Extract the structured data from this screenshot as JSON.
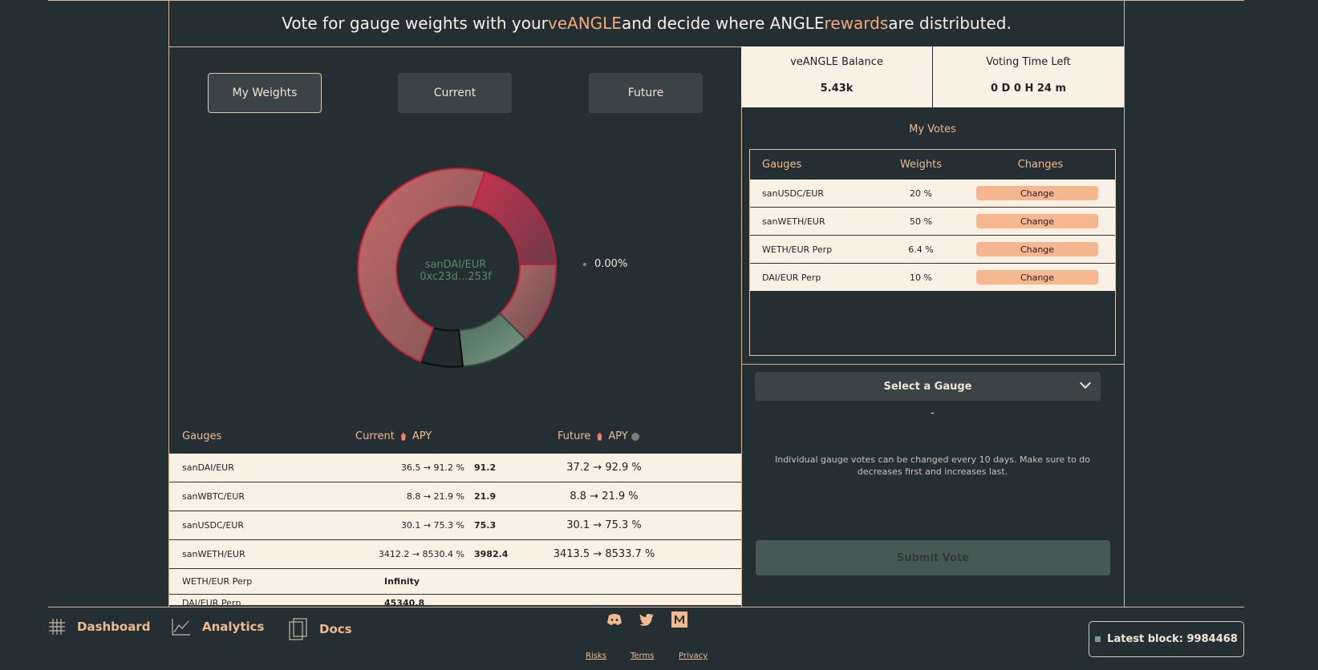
{
  "headline": {
    "part1": "Vote for gauge weights with your ",
    "accent1": "veANGLE",
    "part2": " and decide where ANGLE ",
    "accent2": "rewards",
    "part3": " are distributed."
  },
  "tabs": [
    {
      "label": "My Weights",
      "active": true
    },
    {
      "label": "Current",
      "active": false
    },
    {
      "label": "Future",
      "active": false
    }
  ],
  "donut": {
    "center_name": "sanDAI/EUR",
    "center_address": "0xc23d...253f",
    "legend_value": "0.00%"
  },
  "gauges_table": {
    "headers": {
      "gauges": "Gauges",
      "current": "Current",
      "apy": "APY",
      "future": "Future",
      "apy2": "APY"
    },
    "rows": [
      {
        "name": "sanDAI/EUR",
        "current": "36.5 → 91.2 %",
        "apy": "91.2",
        "future": "37.2 → 92.9 %"
      },
      {
        "name": "sanWBTC/EUR",
        "current": "8.8 → 21.9 %",
        "apy": "21.9",
        "future": "8.8 → 21.9 %"
      },
      {
        "name": "sanUSDC/EUR",
        "current": "30.1 → 75.3 %",
        "apy": "75.3",
        "future": "30.1 → 75.3 %"
      },
      {
        "name": "sanWETH/EUR",
        "current": "3412.2 → 8530.4 %",
        "apy": "3982.4",
        "future": "3413.5 → 8533.7 %"
      },
      {
        "name": "WETH/EUR Perp",
        "current": "",
        "apy": "Infinity",
        "future": ""
      },
      {
        "name": "DAI/EUR Perp",
        "current": "",
        "apy": "45340.8",
        "future": ""
      }
    ]
  },
  "balance": {
    "veangle_label": "veANGLE Balance",
    "veangle_value": "5.43k",
    "time_label": "Voting Time Left",
    "time_value": "0 D 0 H 24 m"
  },
  "my_votes": {
    "title": "My Votes",
    "headers": {
      "gauges": "Gauges",
      "weights": "Weights",
      "changes": "Changes"
    },
    "rows": [
      {
        "name": "sanUSDC/EUR",
        "weight": "20 %",
        "change": "Change"
      },
      {
        "name": "sanWETH/EUR",
        "weight": "50 %",
        "change": "Change"
      },
      {
        "name": "WETH/EUR Perp",
        "weight": "6.4 %",
        "change": "Change"
      },
      {
        "name": "DAI/EUR Perp",
        "weight": "10 %",
        "change": "Change"
      }
    ]
  },
  "vote_form": {
    "select_label": "Select a Gauge",
    "dash": "-",
    "note": "Individual gauge votes can be changed every 10 days. Make sure to do decreases first and increases last.",
    "submit": "Submit Vote"
  },
  "footer": {
    "nav": [
      {
        "label": "Dashboard",
        "icon": "grid-icon"
      },
      {
        "label": "Analytics",
        "icon": "chart-icon"
      },
      {
        "label": "Docs",
        "icon": "docs-icon"
      }
    ],
    "links": [
      "Risks",
      "Terms",
      "Privacy"
    ],
    "latest_block": "Latest block: 9984468"
  },
  "colors": {
    "background": "#232f32",
    "accent": "#f4a979",
    "cream": "#fbf0e4",
    "border": "#d9b79a"
  }
}
